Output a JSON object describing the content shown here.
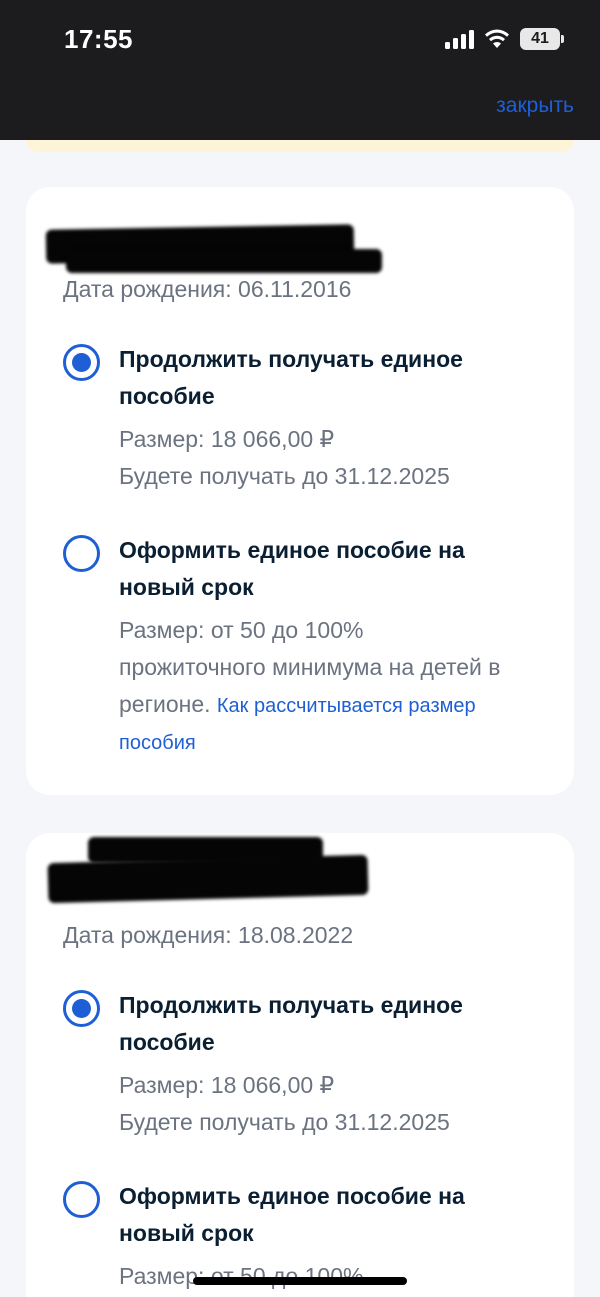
{
  "status_bar": {
    "time": "17:55",
    "battery": "41",
    "icons": [
      "signal-icon",
      "wifi-icon",
      "battery-icon"
    ]
  },
  "header": {
    "close_label": "закрыть"
  },
  "colors": {
    "accent": "#1f5fd6",
    "dark_bar": "#1c1c1e",
    "muted_text": "#6b7380",
    "title_text": "#0b1f33"
  },
  "children": [
    {
      "birth_date": "Дата рождения: 06.11.2016",
      "options": [
        {
          "selected": true,
          "title_line1": "Продолжить получать единое",
          "title_line2": "пособие",
          "size": "Размер: 18 066,00 ₽",
          "until": "Будете получать до 31.12.2025"
        },
        {
          "selected": false,
          "title_line1": "Оформить единое пособие на",
          "title_line2": "новый срок",
          "size_line1": "Размер: от 50 до 100%",
          "size_line2": "прожиточного минимума на детей в",
          "size_line3": "регионе.",
          "link_part1": "Как рассчитывается размер",
          "link_part2": "пособия"
        }
      ]
    },
    {
      "birth_date": "Дата рождения: 18.08.2022",
      "options": [
        {
          "selected": true,
          "title_line1": "Продолжить получать единое",
          "title_line2": "пособие",
          "size": "Размер: 18 066,00 ₽",
          "until": "Будете получать до 31.12.2025"
        },
        {
          "selected": false,
          "title_line1": "Оформить единое пособие на",
          "title_line2": "новый срок",
          "size_line1": "Размер: от 50 до 100%"
        }
      ]
    }
  ]
}
